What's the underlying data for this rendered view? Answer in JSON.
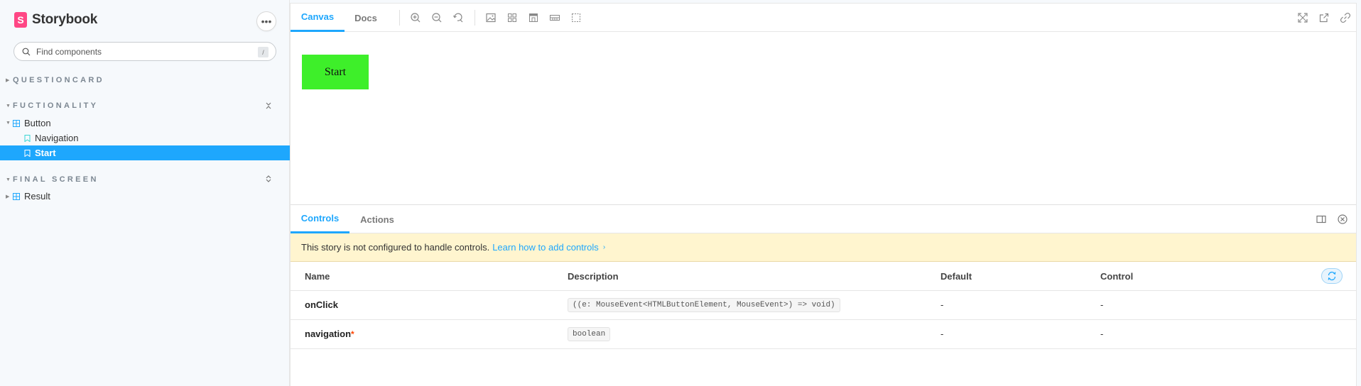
{
  "sidebar": {
    "brand": "Storybook",
    "brand_logo_letter": "S",
    "more_label": "•••",
    "search": {
      "placeholder": "Find components",
      "shortcut": "/"
    },
    "groups": {
      "questioncard": "QUESTIONCARD",
      "fuctionality": "FUCTIONALITY",
      "final_screen": "FINAL SCREEN"
    },
    "items": {
      "button": "Button",
      "navigation": "Navigation",
      "start": "Start",
      "result": "Result"
    }
  },
  "toolbar": {
    "tabs": {
      "canvas": "Canvas",
      "docs": "Docs"
    },
    "icons": [
      "zoom-in-icon",
      "zoom-out-icon",
      "zoom-reset-icon",
      "background-icon",
      "grid-icon",
      "viewport-icon",
      "measure-icon",
      "outline-icon",
      "fullscreen-icon",
      "open-new-tab-icon",
      "copy-link-icon"
    ]
  },
  "canvas": {
    "button_label": "Start",
    "button_color": "#3eef2a"
  },
  "panel": {
    "tabs": {
      "controls": "Controls",
      "actions": "Actions"
    },
    "notice": {
      "text": "This story is not configured to handle controls.",
      "link": "Learn how to add controls",
      "chevron": "›"
    },
    "columns": {
      "name": "Name",
      "description": "Description",
      "default": "Default",
      "control": "Control"
    },
    "rows": [
      {
        "name": "onClick",
        "required": "",
        "description": "((e: MouseEvent<HTMLButtonElement, MouseEvent>) => void)",
        "default": "-",
        "control": "-"
      },
      {
        "name": "navigation",
        "required": "*",
        "description": "boolean",
        "default": "-",
        "control": "-"
      }
    ]
  },
  "colors": {
    "accent": "#1ea7fd",
    "brand": "#ff4785",
    "notice_bg": "#fff5cf"
  }
}
